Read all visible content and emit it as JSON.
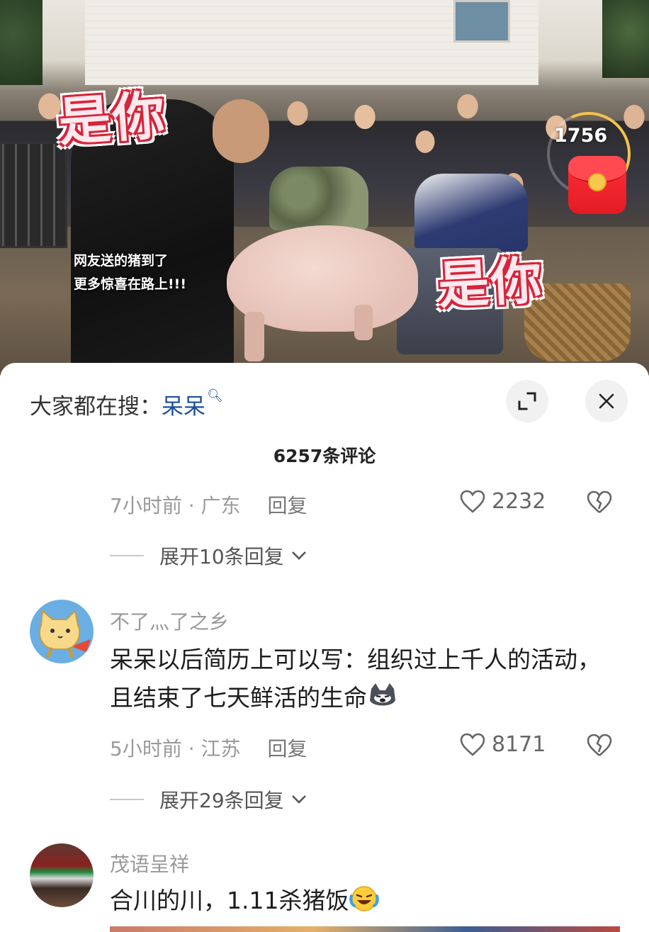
{
  "video": {
    "sticker_top": "是你",
    "sticker_bottom": "是你",
    "caption_line1": "网友送的猪到了",
    "caption_line2": "更多惊喜在路上!!!",
    "redpack_count": "1756"
  },
  "search": {
    "prefix": "大家都在搜：",
    "keyword": "呆呆"
  },
  "comments_header": {
    "count_label": "6257条评论"
  },
  "comments": [
    {
      "time_location": "7小时前 · 广东",
      "reply_label": "回复",
      "likes": "2232",
      "expand_label": "展开10条回复"
    },
    {
      "username": "不了灬了之乡",
      "text": "呆呆以后简历上可以写：组织过上千人的活动，且结束了七天鲜活的生命",
      "time_location": "5小时前 · 江苏",
      "reply_label": "回复",
      "likes": "8171",
      "expand_label": "展开29条回复"
    },
    {
      "username": "茂语呈祥",
      "text": "合川的川，1.11杀猪饭"
    }
  ],
  "colors": {
    "keyword": "#1a4f9b",
    "sticker_red": "#d6243a",
    "redpack": "#e31b25"
  }
}
